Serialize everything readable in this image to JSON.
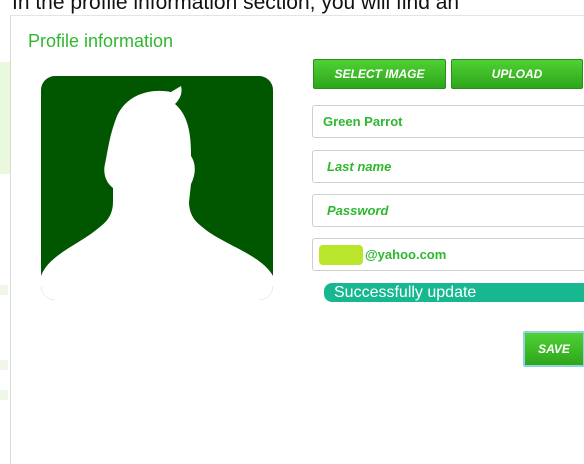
{
  "caption": "In the profile information section, you will find an",
  "panel": {
    "title": "Profile information"
  },
  "buttons": {
    "select_image": "SELECT IMAGE",
    "upload": "UPLOAD",
    "save": "SAVE"
  },
  "fields": {
    "first_name_value": "Green Parrot",
    "last_name_placeholder": "Last name",
    "password_placeholder": "Password",
    "email_value": "@yahoo.com"
  },
  "status": {
    "message": "Successfully update"
  },
  "colors": {
    "accent_green": "#2eb82e",
    "avatar_bg": "#005700",
    "status_teal": "#17b890"
  },
  "icons": {
    "avatar": "person-silhouette-icon"
  }
}
